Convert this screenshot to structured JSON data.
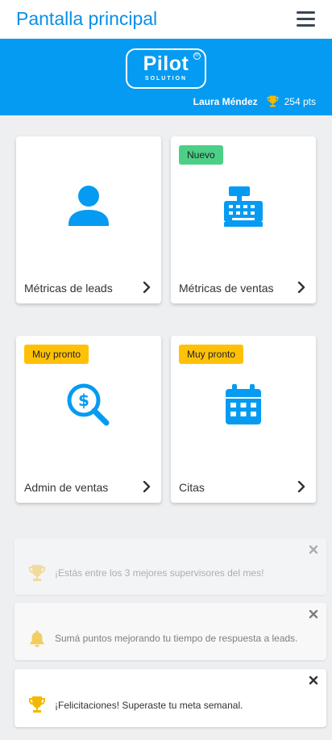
{
  "header": {
    "title": "Pantalla principal",
    "menu_icon": "hamburger-icon"
  },
  "brand": {
    "logo_word": "Pilot",
    "logo_sub": "SOLUTION",
    "logo_mark": "®",
    "user_name": "Laura Méndez",
    "points": "254 pts",
    "background": "#069bf2"
  },
  "cards": [
    {
      "label": "Métricas de leads",
      "badge": "",
      "icon": "user-icon"
    },
    {
      "label": "Métricas de ventas",
      "badge": "Nuevo",
      "icon": "cash-register-icon"
    },
    {
      "label": "Admin de ventas",
      "badge": "Muy pronto",
      "icon": "dollar-search-icon"
    },
    {
      "label": "Citas",
      "badge": "Muy pronto",
      "icon": "calendar-icon"
    }
  ],
  "notifications": [
    {
      "text": "¡Estás entre los 3 mejores supervisores del mes!",
      "icon": "trophy-icon"
    },
    {
      "text": "Sumá puntos mejorando tu tiempo de respuesta a leads.",
      "icon": "bell-icon"
    },
    {
      "text": "¡Felicitaciones! Superaste tu meta semanal.",
      "icon": "trophy-icon"
    }
  ],
  "colors": {
    "accent": "#0a8fe6",
    "icon_blue": "#069bf2",
    "badge_new": "#4ccf86",
    "badge_soon": "#ffc107",
    "trophy": "#f5b800"
  }
}
